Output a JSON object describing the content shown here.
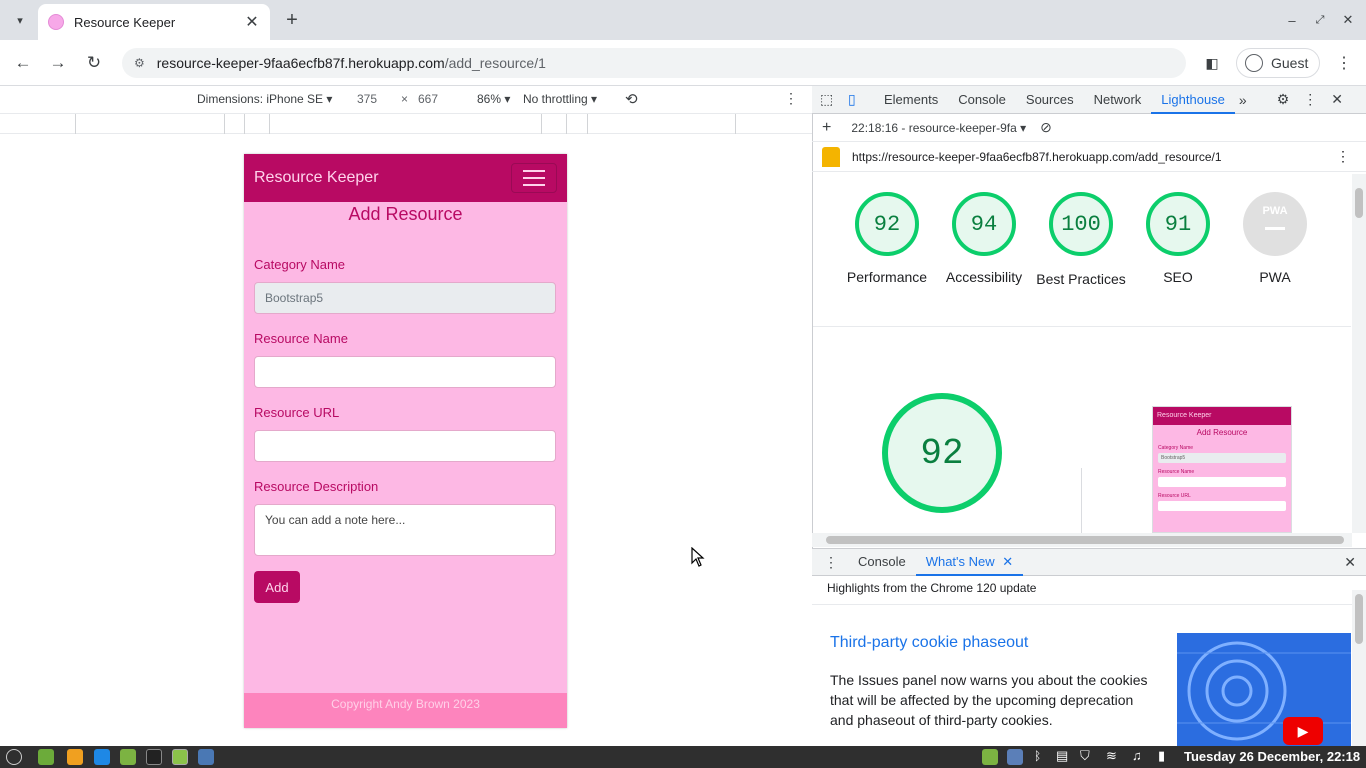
{
  "browser": {
    "tab_title": "Resource Keeper",
    "address_host": "resource-keeper-9faa6ecfb87f.herokuapp.com",
    "address_path": "/add_resource/1",
    "profile_label": "Guest"
  },
  "device_toolbar": {
    "dimensions_label": "Dimensions: iPhone SE",
    "width": "375",
    "times": "×",
    "height": "667",
    "zoom": "86%",
    "throttling": "No throttling"
  },
  "app": {
    "brand": "Resource Keeper",
    "page_title": "Add Resource",
    "category_label": "Category Name",
    "category_value": "Bootstrap5",
    "resource_name_label": "Resource Name",
    "resource_url_label": "Resource URL",
    "description_label": "Resource Description",
    "description_placeholder": "You can add a note here...",
    "add_button": "Add",
    "footer": "Copyright Andy Brown 2023"
  },
  "devtools": {
    "tabs": [
      "Elements",
      "Console",
      "Sources",
      "Network",
      "Lighthouse"
    ],
    "active_tab": "Lighthouse",
    "report_label": "22:18:16 - resource-keeper-9fa",
    "report_url": "https://resource-keeper-9faa6ecfb87f.herokuapp.com/add_resource/1",
    "scores": [
      {
        "label": "Performance",
        "value": "92"
      },
      {
        "label": "Accessibility",
        "value": "94"
      },
      {
        "label": "Best Practices",
        "value": "100"
      },
      {
        "label": "SEO",
        "value": "91"
      }
    ],
    "pwa_label": "PWA",
    "pwa_badge": "PWA",
    "big_score": "92",
    "thumb": {
      "brand": "Resource Keeper",
      "title": "Add Resource",
      "category_label": "Category Name",
      "category_value": "Bootstrap5",
      "name_label": "Resource Name",
      "url_label": "Resource URL"
    }
  },
  "drawer": {
    "tabs": [
      "Console",
      "What's New"
    ],
    "active_tab": "What's New",
    "highlights": "Highlights from the Chrome 120 update",
    "heading": "Third-party cookie phaseout",
    "body": "The Issues panel now warns you about the cookies that will be affected by the upcoming deprecation and phaseout of third-party cookies."
  },
  "taskbar": {
    "clock": "Tuesday 26 December, 22:18"
  },
  "colors": {
    "brand": "#b80a63",
    "phone_bg": "#fdb8e4",
    "footer_bg": "#fd84bd",
    "score_green": "#0cce6b",
    "devtools_accent": "#1a73e8"
  }
}
